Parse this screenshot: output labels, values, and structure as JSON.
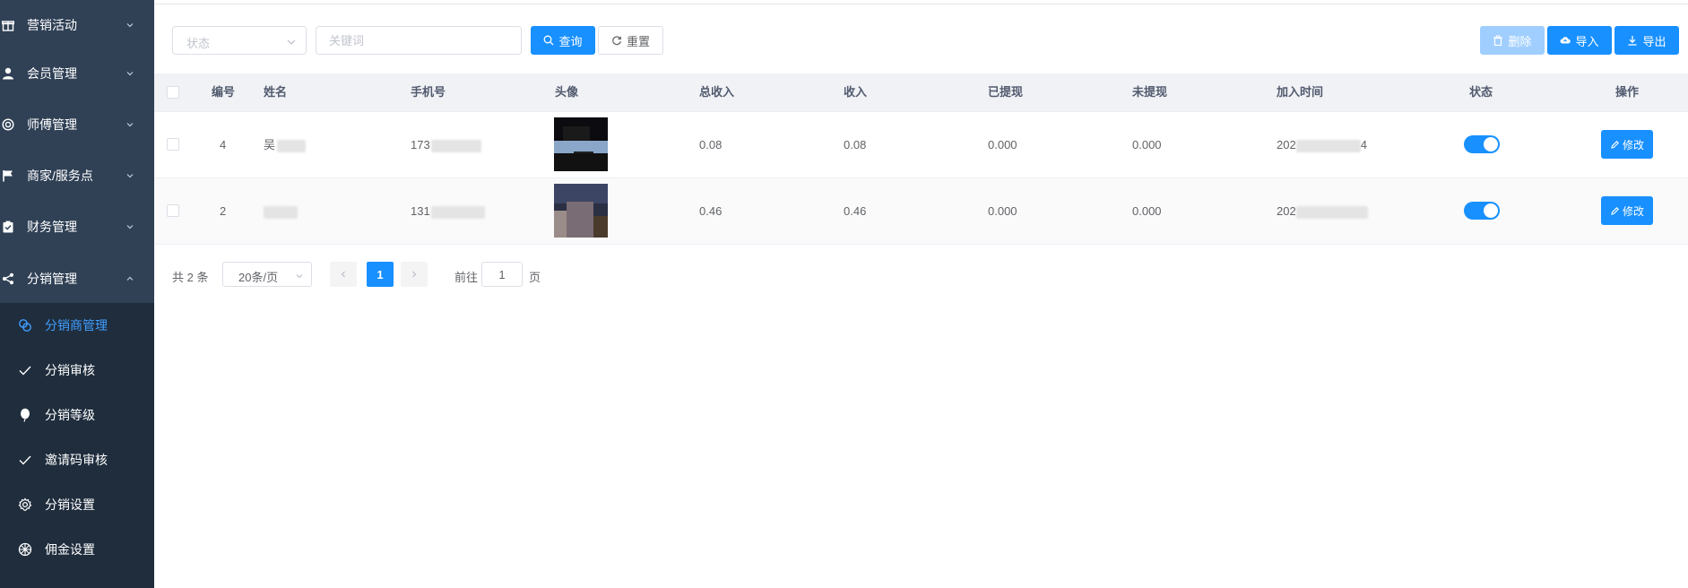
{
  "sidebar": {
    "menu": [
      {
        "label": "营销活动",
        "icon": "gift-icon"
      },
      {
        "label": "会员管理",
        "icon": "user-icon"
      },
      {
        "label": "师傅管理",
        "icon": "settings-ring-icon"
      },
      {
        "label": "商家/服务点",
        "icon": "flag-icon"
      },
      {
        "label": "财务管理",
        "icon": "clipboard-check-icon"
      },
      {
        "label": "分销管理",
        "icon": "share-icon"
      }
    ],
    "submenu": [
      {
        "label": "分销商管理",
        "icon": "link-icon",
        "active": true
      },
      {
        "label": "分销审核",
        "icon": "check-icon"
      },
      {
        "label": "分销等级",
        "icon": "balloon-icon"
      },
      {
        "label": "邀请码审核",
        "icon": "check-icon"
      },
      {
        "label": "分销设置",
        "icon": "gear-icon"
      },
      {
        "label": "佣金设置",
        "icon": "wheel-icon"
      }
    ]
  },
  "filters": {
    "status_placeholder": "状态",
    "keyword_placeholder": "关键词",
    "search_label": "查询",
    "reset_label": "重置"
  },
  "toolbar": {
    "delete_label": "删除",
    "import_label": "导入",
    "export_label": "导出"
  },
  "table": {
    "headers": {
      "id": "编号",
      "name": "姓名",
      "phone": "手机号",
      "avatar": "头像",
      "total_income": "总收入",
      "income": "收入",
      "withdrawn": "已提现",
      "not_withdrawn": "未提现",
      "join_time": "加入时间",
      "status": "状态",
      "action": "操作"
    },
    "rows": [
      {
        "id": "4",
        "name": "吴",
        "phone": "173",
        "total_income": "0.08",
        "income": "0.08",
        "withdrawn": "0.000",
        "not_withdrawn": "0.000",
        "join_time_prefix": "202",
        "join_time_suffix": "4",
        "status_on": true,
        "edit_label": "修改"
      },
      {
        "id": "2",
        "name": "",
        "phone": "131",
        "total_income": "0.46",
        "income": "0.46",
        "withdrawn": "0.000",
        "not_withdrawn": "0.000",
        "join_time_prefix": "202",
        "join_time_suffix": "",
        "status_on": true,
        "edit_label": "修改"
      }
    ]
  },
  "pagination": {
    "total": "共 2 条",
    "page_size": "20条/页",
    "current_page": "1",
    "goto_prefix": "前往",
    "goto_value": "1",
    "goto_suffix": "页"
  },
  "colors": {
    "sidebar_bg": "#304156",
    "submenu_bg": "#1f2d3d",
    "primary": "#1890ff",
    "active_text": "#409eff"
  }
}
